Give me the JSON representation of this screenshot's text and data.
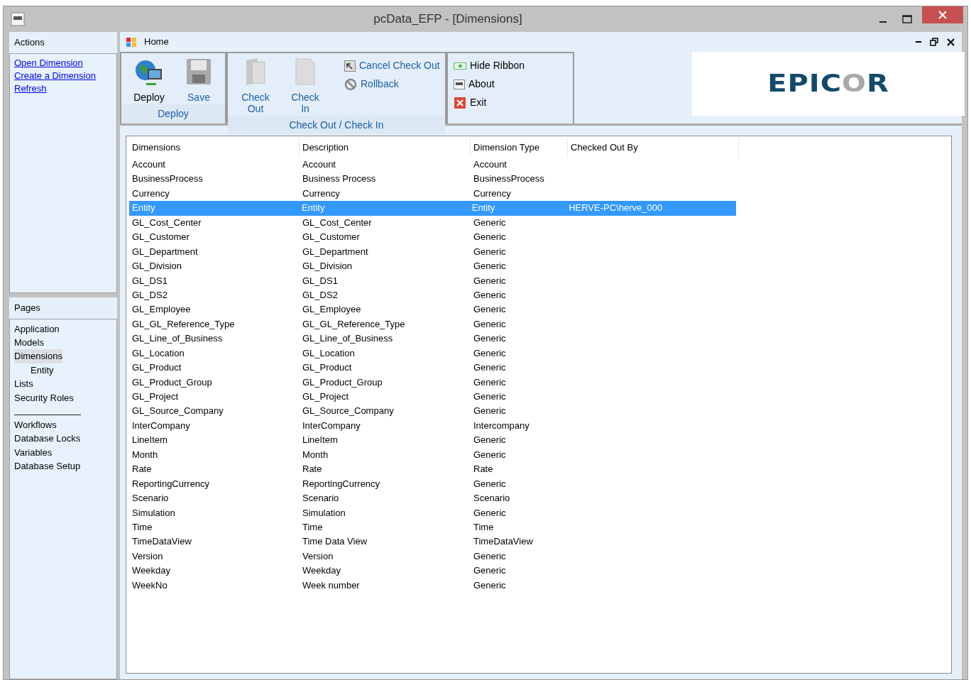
{
  "window": {
    "title": "pcData_EFP - [Dimensions]"
  },
  "actions": {
    "title": "Actions",
    "links": [
      "Open Dimension",
      "Create a Dimension",
      "Refresh"
    ]
  },
  "pages": {
    "title": "Pages",
    "items": [
      {
        "label": "Application",
        "selected": false
      },
      {
        "label": "Models",
        "selected": false
      },
      {
        "label": "Dimensions",
        "selected": true,
        "children": [
          {
            "label": "Entity",
            "selected": false
          }
        ]
      },
      {
        "label": "Lists",
        "selected": false
      },
      {
        "label": "Security Roles",
        "selected": false
      }
    ],
    "more_items": [
      {
        "label": "Workflows",
        "selected": false
      },
      {
        "label": "Database Locks",
        "selected": false
      },
      {
        "label": "Variables",
        "selected": false
      },
      {
        "label": "Database Setup",
        "selected": false
      }
    ]
  },
  "ribbon": {
    "tab": "Home",
    "groups": [
      {
        "label": "Deploy",
        "buttons": [
          {
            "label": "Deploy",
            "kind": "deploy",
            "disabled": false
          },
          {
            "label": "Save",
            "kind": "save",
            "disabled": true
          }
        ]
      },
      {
        "label": "Check Out / Check In",
        "buttons": [
          {
            "label": "Check\nOut",
            "kind": "folder",
            "disabled": true
          },
          {
            "label": "Check\nIn",
            "kind": "page",
            "disabled": true
          }
        ],
        "small": [
          {
            "label": "Cancel Check Out",
            "kind": "undo",
            "disabled": true
          },
          {
            "label": "Rollback",
            "kind": "nosign",
            "disabled": true
          }
        ]
      },
      {
        "small": [
          {
            "label": "Hide Ribbon",
            "kind": "ribbon",
            "disabled": false
          },
          {
            "label": "About",
            "kind": "about",
            "disabled": false
          },
          {
            "label": "Exit",
            "kind": "exit",
            "disabled": false
          }
        ]
      }
    ]
  },
  "logo": [
    {
      "text": "EPIC",
      "color": "#114a6b"
    },
    {
      "text": "O",
      "color": "#a7a9ac"
    },
    {
      "text": "R",
      "color": "#114a6b"
    }
  ],
  "table": {
    "columns": [
      "Dimensions",
      "Description",
      "Dimension Type",
      "Checked Out By"
    ],
    "rows": [
      {
        "cells": [
          "Account",
          "Account",
          "Account",
          ""
        ],
        "selected": false
      },
      {
        "cells": [
          "BusinessProcess",
          "Business Process",
          "BusinessProcess",
          ""
        ],
        "selected": false
      },
      {
        "cells": [
          "Currency",
          "Currency",
          "Currency",
          ""
        ],
        "selected": false
      },
      {
        "cells": [
          "Entity",
          "Entity",
          "Entity",
          "HERVE-PC\\herve_000"
        ],
        "selected": true
      },
      {
        "cells": [
          "GL_Cost_Center",
          "GL_Cost_Center",
          "Generic",
          ""
        ],
        "selected": false
      },
      {
        "cells": [
          "GL_Customer",
          "GL_Customer",
          "Generic",
          ""
        ],
        "selected": false
      },
      {
        "cells": [
          "GL_Department",
          "GL_Department",
          "Generic",
          ""
        ],
        "selected": false
      },
      {
        "cells": [
          "GL_Division",
          "GL_Division",
          "Generic",
          ""
        ],
        "selected": false
      },
      {
        "cells": [
          "GL_DS1",
          "GL_DS1",
          "Generic",
          ""
        ],
        "selected": false
      },
      {
        "cells": [
          "GL_DS2",
          "GL_DS2",
          "Generic",
          ""
        ],
        "selected": false
      },
      {
        "cells": [
          "GL_Employee",
          "GL_Employee",
          "Generic",
          ""
        ],
        "selected": false
      },
      {
        "cells": [
          "GL_GL_Reference_Type",
          "GL_GL_Reference_Type",
          "Generic",
          ""
        ],
        "selected": false
      },
      {
        "cells": [
          "GL_Line_of_Business",
          "GL_Line_of_Business",
          "Generic",
          ""
        ],
        "selected": false
      },
      {
        "cells": [
          "GL_Location",
          "GL_Location",
          "Generic",
          ""
        ],
        "selected": false
      },
      {
        "cells": [
          "GL_Product",
          "GL_Product",
          "Generic",
          ""
        ],
        "selected": false
      },
      {
        "cells": [
          "GL_Product_Group",
          "GL_Product_Group",
          "Generic",
          ""
        ],
        "selected": false
      },
      {
        "cells": [
          "GL_Project",
          "GL_Project",
          "Generic",
          ""
        ],
        "selected": false
      },
      {
        "cells": [
          "GL_Source_Company",
          "GL_Source_Company",
          "Generic",
          ""
        ],
        "selected": false
      },
      {
        "cells": [
          "InterCompany",
          "InterCompany",
          "Intercompany",
          ""
        ],
        "selected": false
      },
      {
        "cells": [
          "LineItem",
          "LineItem",
          "Generic",
          ""
        ],
        "selected": false
      },
      {
        "cells": [
          "Month",
          "Month",
          "Generic",
          ""
        ],
        "selected": false
      },
      {
        "cells": [
          "Rate",
          "Rate",
          "Rate",
          ""
        ],
        "selected": false
      },
      {
        "cells": [
          "ReportingCurrency",
          "ReportingCurrency",
          "Generic",
          ""
        ],
        "selected": false
      },
      {
        "cells": [
          "Scenario",
          "Scenario",
          "Scenario",
          ""
        ],
        "selected": false
      },
      {
        "cells": [
          "Simulation",
          "Simulation",
          "Generic",
          ""
        ],
        "selected": false
      },
      {
        "cells": [
          "Time",
          "Time",
          "Time",
          ""
        ],
        "selected": false
      },
      {
        "cells": [
          "TimeDataView",
          "Time Data View",
          "TimeDataView",
          ""
        ],
        "selected": false
      },
      {
        "cells": [
          "Version",
          "Version",
          "Generic",
          ""
        ],
        "selected": false
      },
      {
        "cells": [
          "Weekday",
          "Weekday",
          "Generic",
          ""
        ],
        "selected": false
      },
      {
        "cells": [
          "WeekNo",
          "Week number",
          "Generic",
          ""
        ],
        "selected": false
      }
    ]
  }
}
